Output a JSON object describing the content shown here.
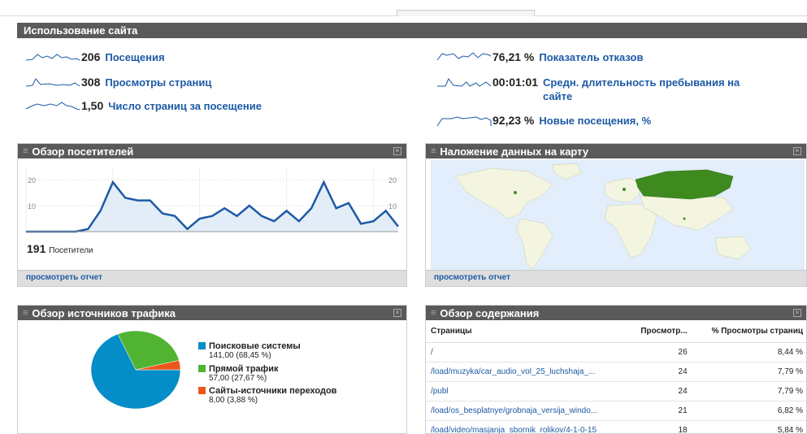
{
  "site_usage": {
    "title": "Использование сайта",
    "metrics": [
      {
        "value": "206",
        "label": "Посещения"
      },
      {
        "value": "308",
        "label": "Просмотры страниц"
      },
      {
        "value": "1,50",
        "label": "Число страниц за посещение"
      },
      {
        "value": "76,21 %",
        "label": "Показатель отказов"
      },
      {
        "value": "00:01:01",
        "label": "Средн. длительность пребывания на сайте"
      },
      {
        "value": "92,23 %",
        "label": "Новые посещения, %"
      }
    ]
  },
  "visitors_panel": {
    "title": "Обзор посетителей",
    "total_value": "191",
    "total_label": "Посетители",
    "footer_link": "просмотреть отчет",
    "chart_data": {
      "type": "area",
      "title": "",
      "xlabel": "",
      "ylabel": "",
      "ylim": [
        0,
        25
      ],
      "yticks": [
        "20",
        "10"
      ],
      "grid": true,
      "series": [
        {
          "values": [
            0,
            0,
            0,
            0,
            0,
            1,
            8,
            19,
            13,
            12,
            12,
            7,
            6,
            1,
            5,
            6,
            9,
            6,
            10,
            6,
            4,
            8,
            4,
            9,
            19,
            9,
            11,
            3,
            4,
            8,
            2
          ]
        }
      ],
      "color": "#1d5aa5"
    }
  },
  "map_panel": {
    "title": "Наложение данных на карту",
    "footer_link": "просмотреть отчет"
  },
  "traffic_panel": {
    "title": "Обзор источников трафика",
    "chart_data": {
      "type": "pie",
      "slices": [
        {
          "name": "Поисковые системы",
          "value": 141.0,
          "label": "141,00 (68,45 %)",
          "color": "#058dc7"
        },
        {
          "name": "Прямой трафик",
          "value": 57.0,
          "label": "57,00 (27,67 %)",
          "color": "#50b432"
        },
        {
          "name": "Сайты-источники переходов",
          "value": 8.0,
          "label": "8,00 (3,88 %)",
          "color": "#ed561b"
        }
      ]
    }
  },
  "content_panel": {
    "title": "Обзор содержания",
    "columns": [
      "Страницы",
      "Просмотр...",
      "% Просмотры страниц"
    ],
    "rows": [
      [
        "/",
        "26",
        "8,44 %"
      ],
      [
        "/load/muzyka/car_audio_vol_25_luchshaja_...",
        "24",
        "7,79 %"
      ],
      [
        "/publ",
        "24",
        "7,79 %"
      ],
      [
        "/load/os_besplatnye/grobnaja_versija_windo...",
        "21",
        "6,82 %"
      ],
      [
        "/load/video/masjanja_sbornik_rolikov/4-1-0-15",
        "18",
        "5,84 %"
      ]
    ]
  },
  "colors": {
    "header": "#5a5a5a",
    "link": "#1d5aa5",
    "map_land": "#f3f5e0",
    "map_highlight": "#3e8a1f",
    "map_water": "#e2eefb"
  }
}
